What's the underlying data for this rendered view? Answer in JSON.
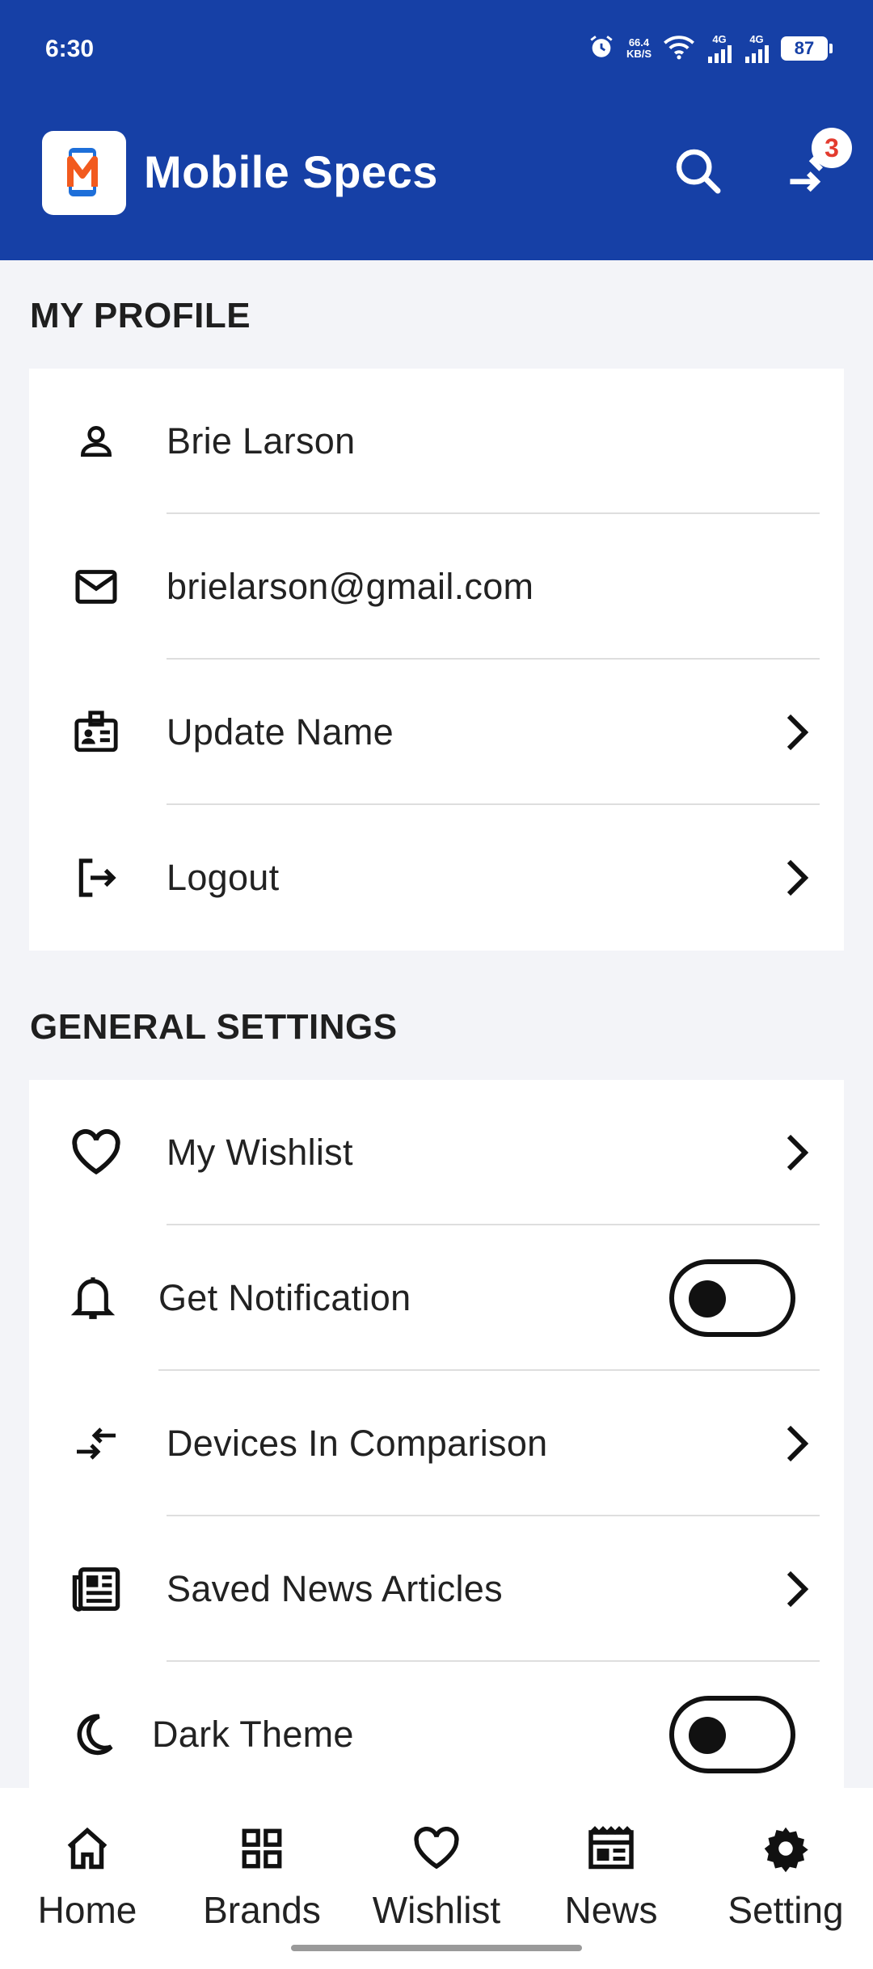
{
  "status_bar": {
    "time": "6:30",
    "net_speed": "66.4\nKB/S",
    "signal1": "4G",
    "signal2": "4G",
    "battery": "87"
  },
  "app_bar": {
    "title": "Mobile Specs",
    "compare_badge": "3"
  },
  "profile": {
    "title": "MY PROFILE",
    "items": [
      {
        "label": "Brie Larson",
        "icon": "person-icon"
      },
      {
        "label": "brielarson@gmail.com",
        "icon": "mail-icon"
      },
      {
        "label": "Update Name",
        "icon": "id-card-icon"
      },
      {
        "label": "Logout",
        "icon": "logout-icon"
      }
    ]
  },
  "general": {
    "title": "GENERAL SETTINGS",
    "items": [
      {
        "label": "My Wishlist",
        "icon": "heart-icon"
      },
      {
        "label": "Get Notification",
        "icon": "bell-icon",
        "toggle": false
      },
      {
        "label": "Devices In Comparison",
        "icon": "compare-icon"
      },
      {
        "label": "Saved News Articles",
        "icon": "news-icon"
      },
      {
        "label": "Dark Theme",
        "icon": "moon-icon",
        "toggle": false
      }
    ]
  },
  "bottom_nav": {
    "items": [
      {
        "label": "Home",
        "icon": "home-icon"
      },
      {
        "label": "Brands",
        "icon": "grid-icon"
      },
      {
        "label": "Wishlist",
        "icon": "heart-icon"
      },
      {
        "label": "News",
        "icon": "newspaper-icon"
      },
      {
        "label": "Setting",
        "icon": "gear-icon"
      }
    ]
  },
  "colors": {
    "primary": "#1640A6",
    "badge": "#E33B2E",
    "background": "#F3F4F8"
  }
}
